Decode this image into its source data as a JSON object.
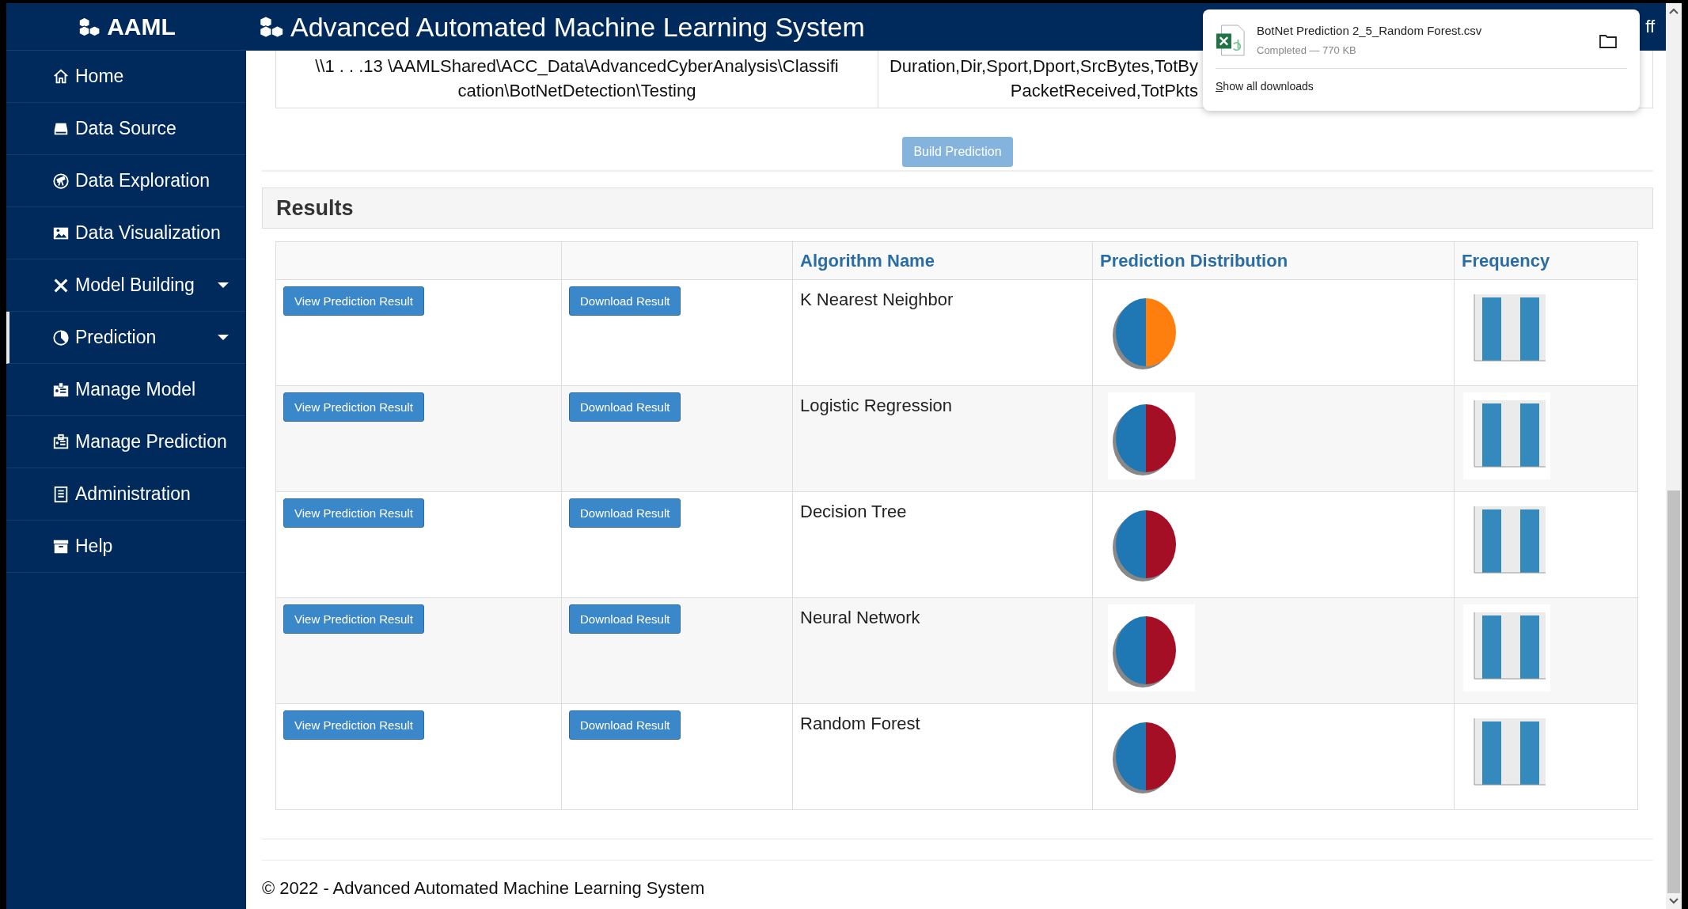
{
  "brand": {
    "title": "AAML"
  },
  "header": {
    "title": "Advanced Automated Machine Learning System",
    "user_link": "ff"
  },
  "sidebar": {
    "items": [
      {
        "label": "Home",
        "has_submenu": false,
        "selected": false
      },
      {
        "label": "Data Source",
        "has_submenu": false,
        "selected": false
      },
      {
        "label": "Data Exploration",
        "has_submenu": false,
        "selected": false
      },
      {
        "label": "Data Visualization",
        "has_submenu": false,
        "selected": false
      },
      {
        "label": "Model Building",
        "has_submenu": true,
        "selected": false
      },
      {
        "label": "Prediction",
        "has_submenu": true,
        "selected": true
      },
      {
        "label": "Manage Model",
        "has_submenu": false,
        "selected": false
      },
      {
        "label": "Manage Prediction",
        "has_submenu": false,
        "selected": false
      },
      {
        "label": "Administration",
        "has_submenu": false,
        "selected": false
      },
      {
        "label": "Help",
        "has_submenu": false,
        "selected": false
      }
    ]
  },
  "source_table": {
    "cells": [
      {
        "lines": [
          "\\\\1 . . .13 \\AAMLShared\\ACC_Data\\AdvancedCyberAnalysis\\Classifi",
          "cation\\BotNetDetection\\Testing"
        ]
      },
      {
        "lines": [
          "Duration,Dir,Sport,Dport,SrcBytes,TotBy",
          "PacketReceived,TotPkts"
        ]
      }
    ]
  },
  "build_button": {
    "label": "Build Prediction",
    "disabled": true
  },
  "results": {
    "title": "Results",
    "columns": [
      "Algorithm Name",
      "Prediction Distribution",
      "Frequency"
    ],
    "rows": [
      {
        "view_button": "View Prediction Result",
        "download_button": "Download Result",
        "algorithm": "K Nearest Neighbor",
        "color": "#ff7f0e"
      },
      {
        "view_button": "View Prediction Result",
        "download_button": "Download Result",
        "algorithm": "Logistic Regression",
        "color": "#a50f26"
      },
      {
        "view_button": "View Prediction Result",
        "download_button": "Download Result",
        "algorithm": "Decision Tree",
        "color": "#a50f26"
      },
      {
        "view_button": "View Prediction Result",
        "download_button": "Download Result",
        "algorithm": "Neural Network",
        "color": "#a50f26"
      },
      {
        "view_button": "View Prediction Result",
        "download_button": "Download Result",
        "algorithm": "Random Forest",
        "color": "#a50f26"
      }
    ]
  },
  "footer": {
    "text": "© 2022 - Advanced Automated Machine Learning System"
  },
  "download_popup": {
    "file_name": "BotNet Prediction 2_5_Random Forest.csv",
    "status": "Completed — 770 KB",
    "show_all": "Show all downloads"
  }
}
